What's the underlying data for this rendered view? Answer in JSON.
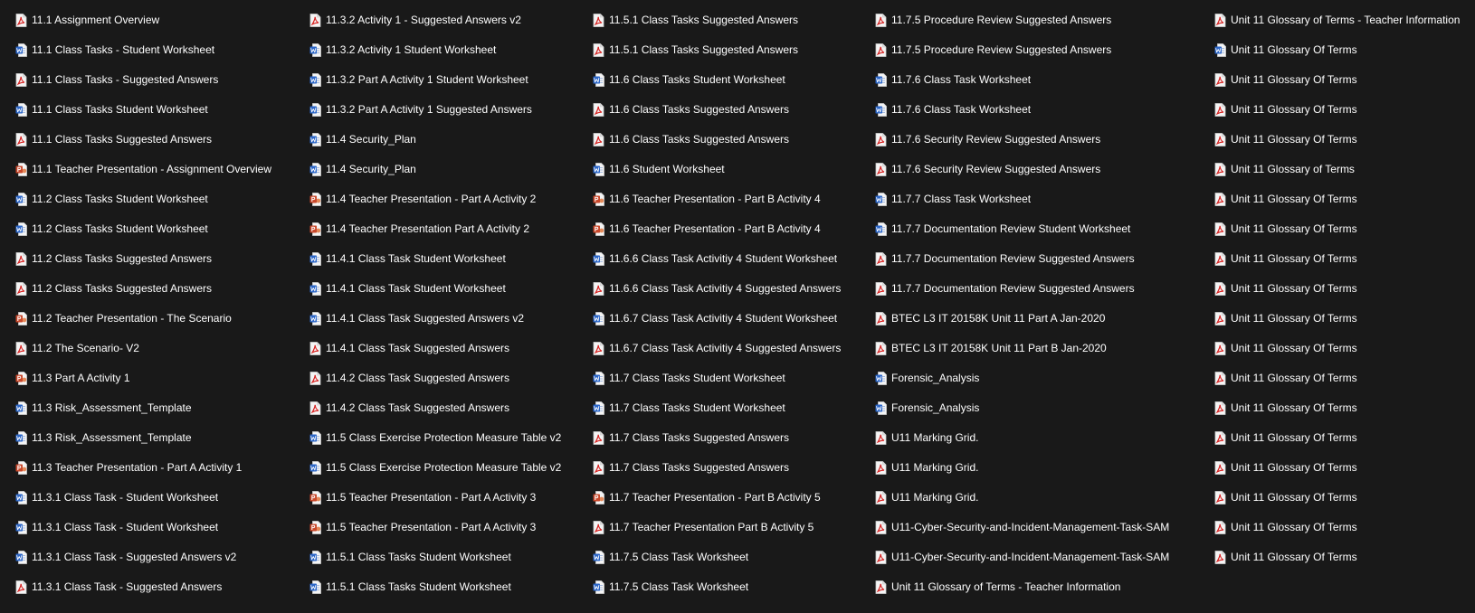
{
  "colors": {
    "background": "#191919",
    "text": "#ffffff",
    "pdf": "#d6201f",
    "word": "#2b66c8",
    "powerpoint": "#c8472a"
  },
  "columns": [
    [
      {
        "label": "11.1 Assignment Overview",
        "type": "pdf"
      },
      {
        "label": "11.1 Class Tasks - Student Worksheet",
        "type": "word"
      },
      {
        "label": "11.1 Class Tasks - Suggested Answers",
        "type": "pdf"
      },
      {
        "label": "11.1 Class Tasks Student Worksheet",
        "type": "word"
      },
      {
        "label": "11.1 Class Tasks Suggested Answers",
        "type": "pdf"
      },
      {
        "label": "11.1 Teacher Presentation - Assignment Overview",
        "type": "powerpoint"
      },
      {
        "label": "11.2 Class Tasks Student Worksheet",
        "type": "word"
      },
      {
        "label": "11.2 Class Tasks Student Worksheet",
        "type": "word"
      },
      {
        "label": "11.2 Class Tasks Suggested Answers",
        "type": "pdf"
      },
      {
        "label": "11.2 Class Tasks Suggested Answers",
        "type": "pdf"
      },
      {
        "label": "11.2 Teacher Presentation - The Scenario",
        "type": "powerpoint"
      },
      {
        "label": "11.2 The Scenario- V2",
        "type": "pdf"
      },
      {
        "label": "11.3 Part A Activity 1",
        "type": "powerpoint"
      },
      {
        "label": "11.3 Risk_Assessment_Template",
        "type": "word"
      },
      {
        "label": "11.3 Risk_Assessment_Template",
        "type": "word"
      },
      {
        "label": "11.3 Teacher Presentation - Part A Activity 1",
        "type": "powerpoint"
      },
      {
        "label": "11.3.1 Class Task - Student Worksheet",
        "type": "word"
      },
      {
        "label": "11.3.1 Class Task - Student Worksheet",
        "type": "word"
      },
      {
        "label": "11.3.1 Class Task - Suggested Answers v2",
        "type": "word"
      },
      {
        "label": "11.3.1 Class Task - Suggested Answers",
        "type": "pdf"
      }
    ],
    [
      {
        "label": "11.3.2 Activity 1 - Suggested Answers v2",
        "type": "pdf"
      },
      {
        "label": "11.3.2 Activity 1 Student Worksheet",
        "type": "word"
      },
      {
        "label": "11.3.2 Part A Activity 1 Student Worksheet",
        "type": "word"
      },
      {
        "label": "11.3.2 Part A Activity 1 Suggested Answers",
        "type": "word"
      },
      {
        "label": "11.4 Security_Plan",
        "type": "word"
      },
      {
        "label": "11.4 Security_Plan",
        "type": "word"
      },
      {
        "label": "11.4 Teacher Presentation - Part A Activity 2",
        "type": "powerpoint"
      },
      {
        "label": "11.4 Teacher Presentation Part A Activity 2",
        "type": "powerpoint"
      },
      {
        "label": "11.4.1 Class Task Student Worksheet",
        "type": "word"
      },
      {
        "label": "11.4.1 Class Task Student Worksheet",
        "type": "word"
      },
      {
        "label": "11.4.1 Class Task Suggested Answers v2",
        "type": "word"
      },
      {
        "label": "11.4.1 Class Task Suggested Answers",
        "type": "pdf"
      },
      {
        "label": "11.4.2 Class Task Suggested Answers",
        "type": "pdf"
      },
      {
        "label": "11.4.2 Class Task Suggested Answers",
        "type": "pdf"
      },
      {
        "label": "11.5 Class Exercise Protection Measure Table v2",
        "type": "word"
      },
      {
        "label": "11.5 Class Exercise Protection Measure Table v2",
        "type": "word"
      },
      {
        "label": "11.5 Teacher Presentation - Part A Activity 3",
        "type": "powerpoint"
      },
      {
        "label": "11.5 Teacher Presentation - Part A Activity 3",
        "type": "powerpoint"
      },
      {
        "label": "11.5.1 Class Tasks Student Worksheet",
        "type": "word"
      },
      {
        "label": "11.5.1 Class Tasks Student Worksheet",
        "type": "word"
      }
    ],
    [
      {
        "label": "11.5.1 Class Tasks Suggested Answers",
        "type": "pdf"
      },
      {
        "label": "11.5.1 Class Tasks Suggested Answers",
        "type": "pdf"
      },
      {
        "label": "11.6 Class Tasks Student Worksheet",
        "type": "word"
      },
      {
        "label": "11.6 Class Tasks Suggested Answers",
        "type": "pdf"
      },
      {
        "label": "11.6 Class Tasks Suggested Answers",
        "type": "pdf"
      },
      {
        "label": "11.6 Student Worksheet",
        "type": "word"
      },
      {
        "label": "11.6 Teacher Presentation - Part B Activity 4",
        "type": "powerpoint"
      },
      {
        "label": "11.6 Teacher Presentation - Part B Activity 4",
        "type": "powerpoint"
      },
      {
        "label": "11.6.6 Class Task Activitiy 4 Student Worksheet",
        "type": "word"
      },
      {
        "label": "11.6.6 Class Task Activitiy 4 Suggested Answers",
        "type": "pdf"
      },
      {
        "label": "11.6.7 Class Task Activitiy 4 Student Worksheet",
        "type": "word"
      },
      {
        "label": "11.6.7 Class Task Activitiy 4 Suggested Answers",
        "type": "pdf"
      },
      {
        "label": "11.7 Class Tasks Student Worksheet",
        "type": "word"
      },
      {
        "label": "11.7 Class Tasks Student Worksheet",
        "type": "word"
      },
      {
        "label": "11.7 Class Tasks Suggested Answers",
        "type": "pdf"
      },
      {
        "label": "11.7 Class Tasks Suggested Answers",
        "type": "pdf"
      },
      {
        "label": "11.7 Teacher Presentation - Part B Activity 5",
        "type": "powerpoint"
      },
      {
        "label": "11.7 Teacher Presentation Part B Activity 5",
        "type": "pdf"
      },
      {
        "label": "11.7.5 Class Task Worksheet",
        "type": "word"
      },
      {
        "label": "11.7.5 Class Task Worksheet",
        "type": "word"
      }
    ],
    [
      {
        "label": "11.7.5 Procedure Review Suggested Answers",
        "type": "pdf"
      },
      {
        "label": "11.7.5 Procedure Review Suggested Answers",
        "type": "pdf"
      },
      {
        "label": "11.7.6 Class Task Worksheet",
        "type": "word"
      },
      {
        "label": "11.7.6 Class Task Worksheet",
        "type": "word"
      },
      {
        "label": "11.7.6 Security Review Suggested Answers",
        "type": "pdf"
      },
      {
        "label": "11.7.6 Security Review Suggested Answers",
        "type": "pdf"
      },
      {
        "label": "11.7.7 Class Task Worksheet",
        "type": "word"
      },
      {
        "label": "11.7.7 Documentation Review Student Worksheet",
        "type": "word"
      },
      {
        "label": "11.7.7 Documentation Review Suggested Answers",
        "type": "pdf"
      },
      {
        "label": "11.7.7 Documentation Review Suggested Answers",
        "type": "pdf"
      },
      {
        "label": "BTEC L3 IT 20158K Unit 11 Part A Jan-2020",
        "type": "pdf"
      },
      {
        "label": "BTEC L3 IT 20158K Unit 11 Part B Jan-2020",
        "type": "pdf"
      },
      {
        "label": "Forensic_Analysis",
        "type": "word"
      },
      {
        "label": "Forensic_Analysis",
        "type": "word"
      },
      {
        "label": "U11 Marking Grid.",
        "type": "pdf"
      },
      {
        "label": "U11 Marking Grid.",
        "type": "pdf"
      },
      {
        "label": "U11 Marking Grid.",
        "type": "pdf"
      },
      {
        "label": "U11-Cyber-Security-and-Incident-Management-Task-SAM",
        "type": "pdf"
      },
      {
        "label": "U11-Cyber-Security-and-Incident-Management-Task-SAM",
        "type": "pdf"
      },
      {
        "label": "Unit 11 Glossary of Terms - Teacher Information",
        "type": "pdf"
      }
    ],
    [
      {
        "label": "Unit 11 Glossary of Terms - Teacher Information",
        "type": "pdf"
      },
      {
        "label": "Unit 11 Glossary Of Terms",
        "type": "word"
      },
      {
        "label": "Unit 11 Glossary Of Terms",
        "type": "pdf"
      },
      {
        "label": "Unit 11 Glossary Of Terms",
        "type": "pdf"
      },
      {
        "label": "Unit 11 Glossary Of Terms",
        "type": "pdf"
      },
      {
        "label": "Unit 11 Glossary of Terms",
        "type": "pdf"
      },
      {
        "label": "Unit 11 Glossary Of Terms",
        "type": "pdf"
      },
      {
        "label": "Unit 11 Glossary Of Terms",
        "type": "pdf"
      },
      {
        "label": "Unit 11 Glossary Of Terms",
        "type": "pdf"
      },
      {
        "label": "Unit 11 Glossary Of Terms",
        "type": "pdf"
      },
      {
        "label": "Unit 11 Glossary Of Terms",
        "type": "pdf"
      },
      {
        "label": "Unit 11 Glossary Of Terms",
        "type": "pdf"
      },
      {
        "label": "Unit 11 Glossary Of Terms",
        "type": "pdf"
      },
      {
        "label": "Unit 11 Glossary Of Terms",
        "type": "pdf"
      },
      {
        "label": "Unit 11 Glossary Of Terms",
        "type": "pdf"
      },
      {
        "label": "Unit 11 Glossary Of Terms",
        "type": "pdf"
      },
      {
        "label": "Unit 11 Glossary Of Terms",
        "type": "pdf"
      },
      {
        "label": "Unit 11 Glossary Of Terms",
        "type": "pdf"
      },
      {
        "label": "Unit 11 Glossary Of Terms",
        "type": "pdf"
      }
    ]
  ]
}
